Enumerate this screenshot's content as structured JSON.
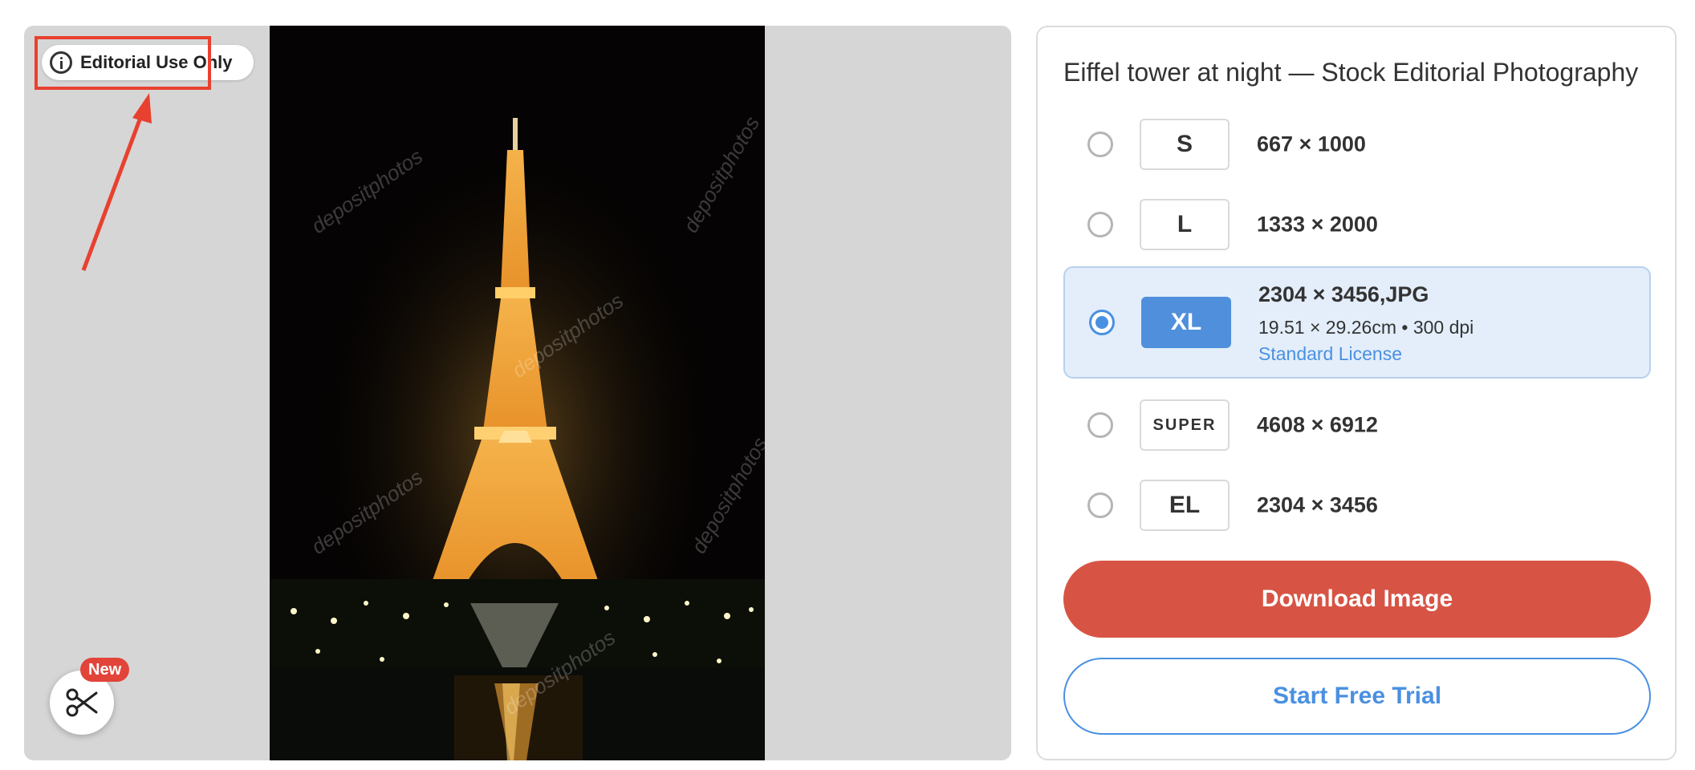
{
  "preview": {
    "badge_label": "Editorial Use Only",
    "new_badge": "New",
    "watermark": "depositphotos"
  },
  "panel": {
    "title": "Eiffel tower at night — Stock Editorial Photography",
    "sizes": [
      {
        "code": "S",
        "dims": "667 × 1000",
        "selected": false
      },
      {
        "code": "L",
        "dims": "1333 × 2000",
        "selected": false
      },
      {
        "code": "XL",
        "dims": "2304 × 3456,JPG",
        "detail": "19.51 × 29.26cm • 300 dpi",
        "license": "Standard License",
        "selected": true
      },
      {
        "code": "SUPER",
        "dims": "4608 × 6912",
        "selected": false
      },
      {
        "code": "EL",
        "dims": "2304 × 3456",
        "selected": false
      }
    ],
    "download_label": "Download Image",
    "trial_label": "Start Free Trial"
  },
  "colors": {
    "accent_blue": "#4a90e2",
    "download_red": "#d75445",
    "annotation_red": "#e8412f",
    "selected_bg": "#e3eefa"
  },
  "icons": [
    "info-icon",
    "scissors-icon",
    "radio-icon"
  ]
}
